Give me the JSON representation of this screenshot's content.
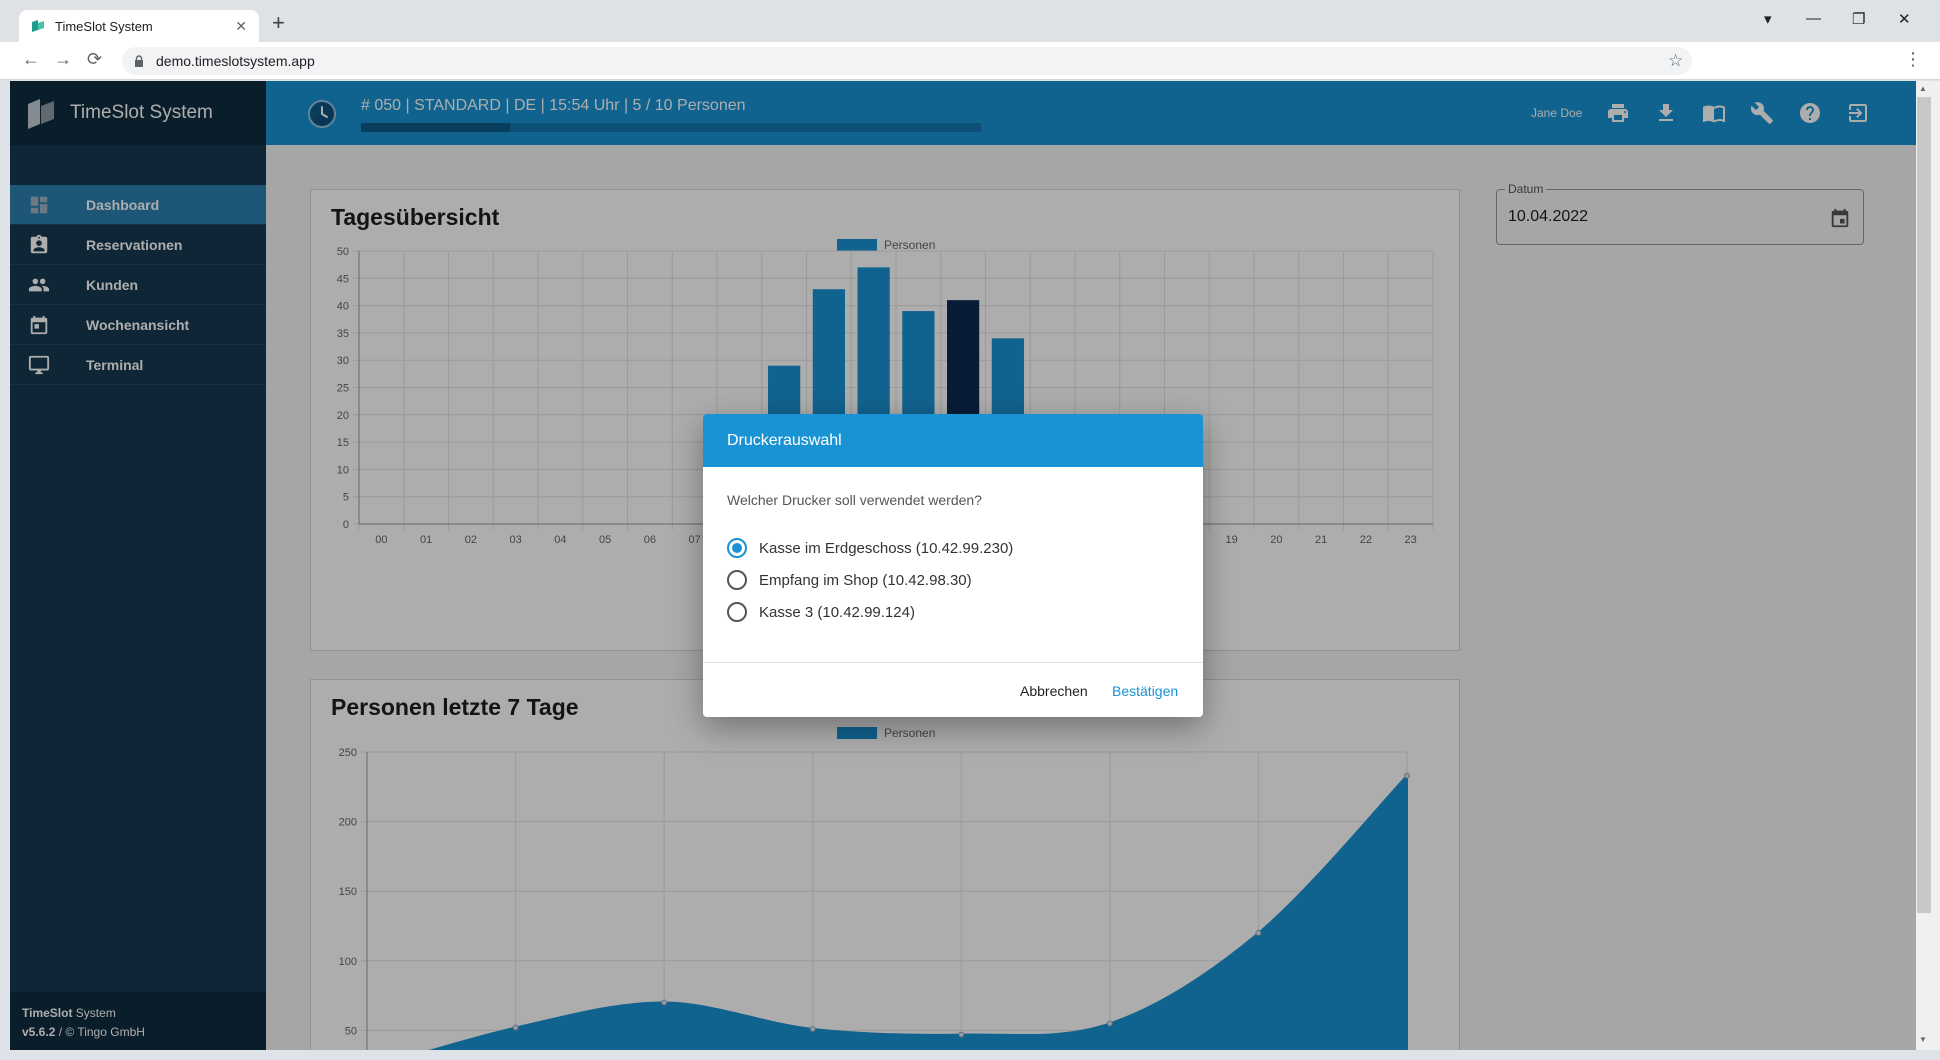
{
  "browser": {
    "tab_title": "TimeSlot System",
    "tab_close": "✕",
    "new_tab": "+",
    "url": "demo.timeslotsystem.app",
    "back": "←",
    "forward": "→",
    "reload": "⟳",
    "star": "☆",
    "menu": "⋮",
    "win_dropdown": "▾",
    "win_min": "—",
    "win_max": "❐",
    "win_close": "✕"
  },
  "app": {
    "brand": "TimeSlot System",
    "nav": [
      {
        "label": "Dashboard",
        "icon": "dashboard-icon",
        "active": true
      },
      {
        "label": "Reservationen",
        "icon": "reservations-icon",
        "active": false
      },
      {
        "label": "Kunden",
        "icon": "customers-icon",
        "active": false
      },
      {
        "label": "Wochenansicht",
        "icon": "calendar-icon",
        "active": false
      },
      {
        "label": "Terminal",
        "icon": "monitor-icon",
        "active": false
      }
    ],
    "footer": {
      "brand_bold": "TimeSlot",
      "brand_rest": " System",
      "version": "v5.6.2",
      "copyright": " / © Tingo GmbH"
    }
  },
  "header": {
    "info": "# 050  |  STANDARD  |  DE  |  15:54 Uhr  |  5 / 10 Personen",
    "capacity_progress": 0.24,
    "user": "Jane Doe",
    "icons": [
      "printer-icon",
      "download-icon",
      "book-icon",
      "wrench-icon",
      "help-icon",
      "logout-icon"
    ]
  },
  "date_field": {
    "label": "Datum",
    "value": "10.04.2022"
  },
  "cards": {
    "daily_title": "Tagesübersicht",
    "weekly_title": "Personen letzte 7 Tage"
  },
  "dialog": {
    "title": "Druckerauswahl",
    "question": "Welcher Drucker soll verwendet werden?",
    "options": [
      {
        "label": "Kasse im Erdgeschoss (10.42.99.230)",
        "selected": true
      },
      {
        "label": "Empfang im Shop (10.42.98.30)",
        "selected": false
      },
      {
        "label": "Kasse 3 (10.42.99.124)",
        "selected": false
      }
    ],
    "cancel": "Abbrechen",
    "confirm": "Bestätigen"
  },
  "colors": {
    "accent": "#1993d3",
    "sidebar": "#16384f",
    "bar_dark": "#0c2a52"
  },
  "chart_data": [
    {
      "type": "bar",
      "title": "Tagesübersicht",
      "legend": "Personen",
      "legend_position": "top",
      "categories": [
        "00",
        "01",
        "02",
        "03",
        "04",
        "05",
        "06",
        "07",
        "08",
        "09",
        "10",
        "11",
        "12",
        "13",
        "14",
        "15",
        "16",
        "17",
        "18",
        "19",
        "20",
        "21",
        "22",
        "23"
      ],
      "values": [
        0,
        0,
        0,
        0,
        0,
        0,
        0,
        0,
        0,
        29,
        43,
        47,
        39,
        41,
        34,
        0,
        0,
        0,
        0,
        0,
        0,
        0,
        0,
        0
      ],
      "current_hour": "13",
      "ylim": [
        0,
        50
      ],
      "yticks": [
        0,
        5,
        10,
        15,
        20,
        25,
        30,
        35,
        40,
        45,
        50
      ],
      "grid": true
    },
    {
      "type": "area",
      "title": "Personen letzte 7 Tage",
      "legend": "Personen",
      "legend_position": "top",
      "values": [
        22,
        52,
        70,
        51,
        47,
        55,
        120,
        233
      ],
      "ylim": [
        0,
        250
      ],
      "yticks": [
        50,
        100,
        150,
        200,
        250
      ],
      "grid": true
    }
  ]
}
